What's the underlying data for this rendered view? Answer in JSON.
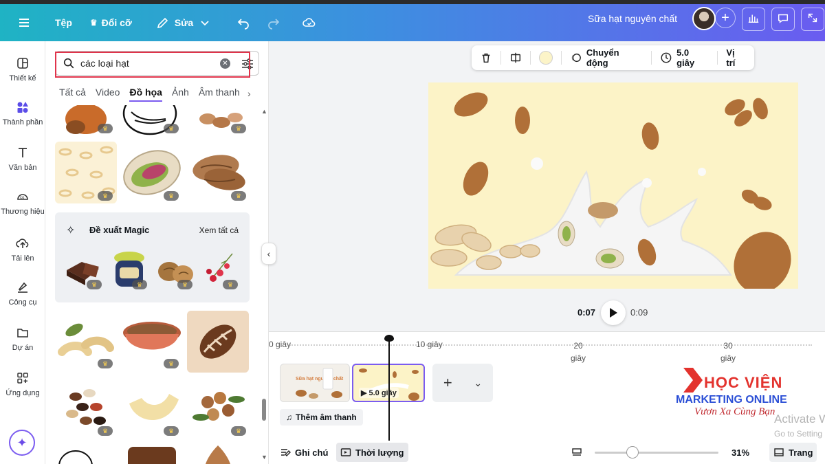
{
  "topbar": {
    "file_label": "Tệp",
    "resize_label": "Đổi cỡ",
    "edit_label": "Sửa",
    "doc_title": "Sữa hạt nguyên chất"
  },
  "rail": {
    "items": [
      {
        "label": "Thiết kế"
      },
      {
        "label": "Thành phần"
      },
      {
        "label": "Văn bản"
      },
      {
        "label": "Thương hiệu"
      },
      {
        "label": "Tải lên"
      },
      {
        "label": "Công cụ"
      },
      {
        "label": "Dự án"
      },
      {
        "label": "Ứng dụng"
      }
    ]
  },
  "panel": {
    "search_value": "các loại hạt",
    "tabs": [
      "Tất cả",
      "Video",
      "Đồ họa",
      "Ảnh",
      "Âm thanh"
    ],
    "magic_title": "Đề xuất Magic",
    "magic_see_all": "Xem tất cả"
  },
  "floating_toolbar": {
    "animate_label": "Chuyển động",
    "duration_label": "5.0 giây",
    "position_label": "Vị trí"
  },
  "player": {
    "current_time": "0:07",
    "total_time": "0:09"
  },
  "timeline": {
    "ruler": [
      "0 giây",
      "10 giây",
      "20 giây",
      "30 giây"
    ],
    "clip1_text": "Sữa hạt nguyên chất",
    "clip2_duration": "5.0 giây",
    "add_audio": "Thêm âm thanh",
    "notes_label": "Ghi chú",
    "duration_label": "Thời lượng",
    "zoom": "31%",
    "pages_label": "Trang"
  },
  "watermark": {
    "brand_title": "HỌC VIỆN",
    "brand_sub": "MARKETING ONLINE",
    "tagline": "Vươn Xa Cùng Bạn"
  },
  "os": {
    "activate_line1": "Activate Wi",
    "activate_line2": "Go to Setting"
  },
  "colors": {
    "accent": "#7b5cf0",
    "canvas_bg": "#fcf3c7",
    "search_highlight": "#e0344b"
  }
}
